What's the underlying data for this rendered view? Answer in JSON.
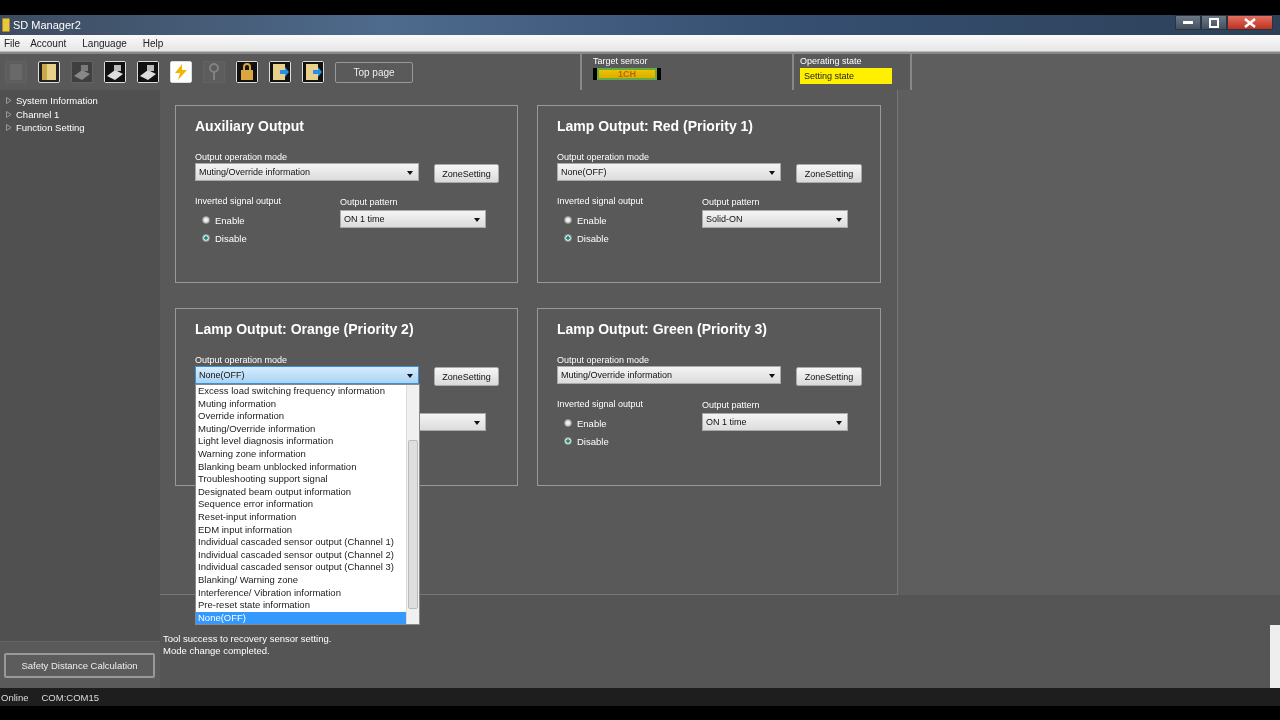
{
  "window": {
    "title": "SD Manager2"
  },
  "menu": [
    "File",
    "Account",
    "Language",
    "Help"
  ],
  "toolbar": {
    "icons": [
      {
        "kind": "document",
        "disabled": true
      },
      {
        "kind": "folder",
        "disabled": false
      },
      {
        "kind": "device",
        "disabled": true
      },
      {
        "kind": "device",
        "disabled": false
      },
      {
        "kind": "device",
        "disabled": false
      },
      {
        "kind": "lightning",
        "disabled": false
      },
      {
        "kind": "key",
        "disabled": true
      },
      {
        "kind": "lock",
        "disabled": false
      },
      {
        "kind": "folder-arrow",
        "disabled": false
      },
      {
        "kind": "folder-arrow",
        "disabled": false
      }
    ],
    "top_page_button": "Top page"
  },
  "target_sensor": {
    "label": "Target sensor",
    "value": "1CH"
  },
  "operating_state": {
    "label": "Operating state",
    "value": "Setting state"
  },
  "sidebar": {
    "items": [
      {
        "label": "System Information",
        "expanded": false
      },
      {
        "label": "Channel 1",
        "expanded": false
      },
      {
        "label": "Function Setting",
        "expanded": false
      }
    ],
    "button": "Safety Distance Calculation"
  },
  "panels": [
    {
      "title": "Auxiliary Output",
      "mode_label": "Output operation mode",
      "mode": "Muting/Override information",
      "zone_button": "ZoneSetting",
      "inverted_label": "Inverted signal output",
      "options": [
        {
          "label": "Enable",
          "selected": false
        },
        {
          "label": "Disable",
          "selected": true
        }
      ],
      "pattern_label": "Output pattern",
      "pattern": "ON 1 time"
    },
    {
      "title": "Lamp Output: Red (Priority 1)",
      "mode_label": "Output operation mode",
      "mode": "None(OFF)",
      "zone_button": "ZoneSetting",
      "inverted_label": "Inverted signal output",
      "options": [
        {
          "label": "Enable",
          "selected": false
        },
        {
          "label": "Disable",
          "selected": true
        }
      ],
      "pattern_label": "Output pattern",
      "pattern": "Solid-ON"
    },
    {
      "title": "Lamp Output: Orange (Priority 2)",
      "mode_label": "Output operation mode",
      "mode": "None(OFF)",
      "zone_button": "ZoneSetting",
      "open": true,
      "list": [
        {
          "label": "Excess load switching frequency information",
          "selected": false
        },
        {
          "label": "Muting information",
          "selected": false
        },
        {
          "label": "Override information",
          "selected": false
        },
        {
          "label": "Muting/Override information",
          "selected": false
        },
        {
          "label": "Light level diagnosis information",
          "selected": false
        },
        {
          "label": "Warning zone information",
          "selected": false
        },
        {
          "label": "Blanking beam unblocked information",
          "selected": false
        },
        {
          "label": "Troubleshooting support signal",
          "selected": false
        },
        {
          "label": "Designated beam output information",
          "selected": false
        },
        {
          "label": "Sequence error information",
          "selected": false
        },
        {
          "label": "Reset-input information",
          "selected": false
        },
        {
          "label": "EDM input information",
          "selected": false
        },
        {
          "label": "Individual cascaded sensor output (Channel 1)",
          "selected": false
        },
        {
          "label": "Individual cascaded sensor output (Channel 2)",
          "selected": false
        },
        {
          "label": "Individual cascaded sensor output (Channel 3)",
          "selected": false
        },
        {
          "label": "Blanking/ Warning zone",
          "selected": false
        },
        {
          "label": "Interference/ Vibration information",
          "selected": false
        },
        {
          "label": "Pre-reset state information",
          "selected": false
        },
        {
          "label": "None(OFF)",
          "selected": true
        }
      ]
    },
    {
      "title": "Lamp Output: Green (Priority 3)",
      "mode_label": "Output operation mode",
      "mode": "Muting/Override information",
      "zone_button": "ZoneSetting",
      "inverted_label": "Inverted signal output",
      "options": [
        {
          "label": "Enable",
          "selected": false
        },
        {
          "label": "Disable",
          "selected": true
        }
      ],
      "pattern_label": "Output pattern",
      "pattern": "ON 1 time"
    }
  ],
  "log": [
    "Tool success to recovery sensor setting.",
    "Mode change completed."
  ],
  "status_bar": [
    "Online",
    "COM:COM15"
  ]
}
